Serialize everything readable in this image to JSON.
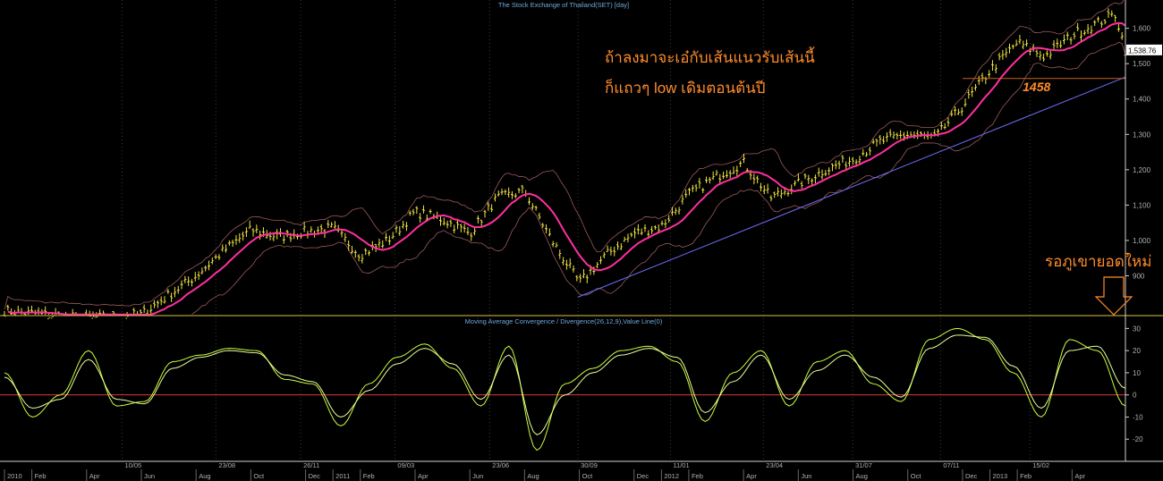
{
  "chart_data": [
    {
      "type": "candlestick",
      "title": "The Stock Exchange of Thailand(SET) [day]",
      "ylim": [
        790,
        1680
      ],
      "y_ticks": [
        900,
        1000,
        1100,
        1200,
        1300,
        1400,
        1500,
        1600
      ],
      "y_tick_labels": [
        "900",
        "1,000",
        "1,100",
        "1,200",
        "1,300",
        "1,400",
        "1,500",
        "1,600"
      ],
      "last_price": 1538.76,
      "last_price_label": "1,538.76",
      "support_level": 1458,
      "support_label": "1458",
      "trendline": {
        "start": [
          "30/09 2011",
          840
        ],
        "end": [
          "May 2013",
          1462
        ]
      },
      "anchors": [
        {
          "x": "Jan 2010",
          "close": 800
        },
        {
          "x": "Apr 2010",
          "close": 780
        },
        {
          "x": "Jun 2010",
          "close": 790
        },
        {
          "x": "Aug 2010",
          "close": 900
        },
        {
          "x": "Sep 2010",
          "close": 970
        },
        {
          "x": "Oct 2010",
          "close": 1030
        },
        {
          "x": "Nov 2010",
          "close": 1010
        },
        {
          "x": "Dec 2010",
          "close": 1025
        },
        {
          "x": "Jan 2011",
          "close": 1035
        },
        {
          "x": "Feb 2011",
          "close": 960
        },
        {
          "x": "Mar 2011",
          "close": 1000
        },
        {
          "x": "Apr 2011",
          "close": 1080
        },
        {
          "x": "May 2011",
          "close": 1060
        },
        {
          "x": "Jun 2011",
          "close": 1020
        },
        {
          "x": "Jul 2011",
          "close": 1120
        },
        {
          "x": "Aug 2011",
          "close": 1140
        },
        {
          "x": "Sep 2011",
          "close": 1000
        },
        {
          "x": "Oct 2011",
          "close": 880
        },
        {
          "x": "Nov 2011",
          "close": 960
        },
        {
          "x": "Dec 2011",
          "close": 1020
        },
        {
          "x": "Jan 2012",
          "close": 1040
        },
        {
          "x": "Feb 2012",
          "close": 1130
        },
        {
          "x": "Mar 2012",
          "close": 1180
        },
        {
          "x": "Apr 2012",
          "close": 1220
        },
        {
          "x": "May 2012",
          "close": 1120
        },
        {
          "x": "Jun 2012",
          "close": 1160
        },
        {
          "x": "Jul 2012",
          "close": 1200
        },
        {
          "x": "Aug 2012",
          "close": 1230
        },
        {
          "x": "Sep 2012",
          "close": 1280
        },
        {
          "x": "Oct 2012",
          "close": 1300
        },
        {
          "x": "Nov 2012",
          "close": 1290
        },
        {
          "x": "Dec 2012",
          "close": 1380
        },
        {
          "x": "Jan 2013",
          "close": 1480
        },
        {
          "x": "Feb 2013",
          "close": 1560
        },
        {
          "x": "Mar 2013",
          "close": 1520
        },
        {
          "x": "Apr 2013",
          "close": 1580
        },
        {
          "x": "May 2013",
          "close": 1640
        },
        {
          "x": "May 2013",
          "close": 1538.76
        }
      ],
      "annotations": [
        "ถ้าลงมาจะเอ๋กับเส้นแนวรับเส้นนี้",
        "ก็แถวๆ low เดิมตอนต้นปี",
        "รอภูเขายอดใหม่"
      ]
    },
    {
      "type": "line",
      "title": "Moving Average Convergence / Divergence(26,12,9),Value Line(0)",
      "ylim": [
        -30,
        35
      ],
      "y_ticks": [
        -20,
        -10,
        0,
        10,
        20,
        30
      ],
      "y_tick_labels": [
        "-20",
        "-10",
        "0",
        "10",
        "20",
        "30"
      ],
      "series": [
        {
          "values": [
            10,
            -10,
            0,
            20,
            -5,
            -3,
            15,
            18,
            21,
            20,
            7,
            5,
            -14,
            5,
            17,
            23,
            12,
            -5,
            22,
            -25,
            5,
            12,
            20,
            22,
            15,
            -12,
            10,
            20,
            -5,
            15,
            20,
            5,
            -3,
            25,
            30,
            25,
            10,
            -10,
            25,
            20,
            -5
          ]
        },
        {
          "values": [
            8,
            -6,
            -2,
            16,
            -2,
            -4,
            12,
            17,
            20,
            19,
            9,
            6,
            -10,
            2,
            14,
            21,
            14,
            -2,
            18,
            -18,
            0,
            10,
            18,
            21,
            17,
            -8,
            6,
            18,
            -2,
            11,
            18,
            8,
            -1,
            21,
            27,
            26,
            13,
            -6,
            20,
            22,
            3
          ]
        }
      ]
    }
  ],
  "x_axis_labels": [
    {
      "label": "2010",
      "x": "Jan 2010"
    },
    {
      "label": "Feb",
      "x": "Feb 2010"
    },
    {
      "label": "Apr",
      "x": "Apr 2010"
    },
    {
      "label": "Jun",
      "x": "Jun 2010"
    },
    {
      "label": "Aug",
      "x": "Aug 2010"
    },
    {
      "label": "Oct",
      "x": "Oct 2010"
    },
    {
      "label": "Dec",
      "x": "Dec 2010"
    },
    {
      "label": "2011",
      "x": "Jan 2011"
    },
    {
      "label": "Feb",
      "x": "Feb 2011"
    },
    {
      "label": "Apr",
      "x": "Apr 2011"
    },
    {
      "label": "Jun",
      "x": "Jun 2011"
    },
    {
      "label": "Aug",
      "x": "Aug 2011"
    },
    {
      "label": "Oct",
      "x": "Oct 2011"
    },
    {
      "label": "Dec",
      "x": "Dec 2011"
    },
    {
      "label": "2012",
      "x": "Jan 2012"
    },
    {
      "label": "Feb",
      "x": "Feb 2012"
    },
    {
      "label": "Apr",
      "x": "Apr 2012"
    },
    {
      "label": "Jun",
      "x": "Jun 2012"
    },
    {
      "label": "Aug",
      "x": "Aug 2012"
    },
    {
      "label": "Oct",
      "x": "Oct 2012"
    },
    {
      "label": "Dec",
      "x": "Dec 2012"
    },
    {
      "label": "2013",
      "x": "Jan 2013"
    },
    {
      "label": "Feb",
      "x": "Feb 2013"
    },
    {
      "label": "Apr",
      "x": "Apr 2013"
    }
  ],
  "x_axis_markers": [
    {
      "label": "10/05",
      "x": "10/05/2010"
    },
    {
      "label": "23/08",
      "x": "23/08/2010"
    },
    {
      "label": "26/11",
      "x": "26/11/2010"
    },
    {
      "label": "09/03",
      "x": "09/03/2011"
    },
    {
      "label": "23/06",
      "x": "23/06/2011"
    },
    {
      "label": "30/09",
      "x": "30/09/2011"
    },
    {
      "label": "11/01",
      "x": "11/01/2012"
    },
    {
      "label": "23/04",
      "x": "23/04/2012"
    },
    {
      "label": "31/07",
      "x": "31/07/2012"
    },
    {
      "label": "07/11",
      "x": "07/11/2012"
    },
    {
      "label": "15/02",
      "x": "15/02/2013"
    }
  ],
  "colors": {
    "background": "#000000",
    "candles": "#f0e442",
    "ma": "#ff2fa0",
    "bands": "#9a5a5a",
    "trendline": "#7070ff",
    "annotation": "#ff8c2a",
    "axis_text": "#b0b0b0",
    "title_text": "#6fa8dc",
    "macd": "#c8ff3a",
    "signal": "#e8ff9a",
    "zero_line": "#ff4040",
    "panel_border": "#d6c341",
    "last_price_box": "#ffffff"
  }
}
